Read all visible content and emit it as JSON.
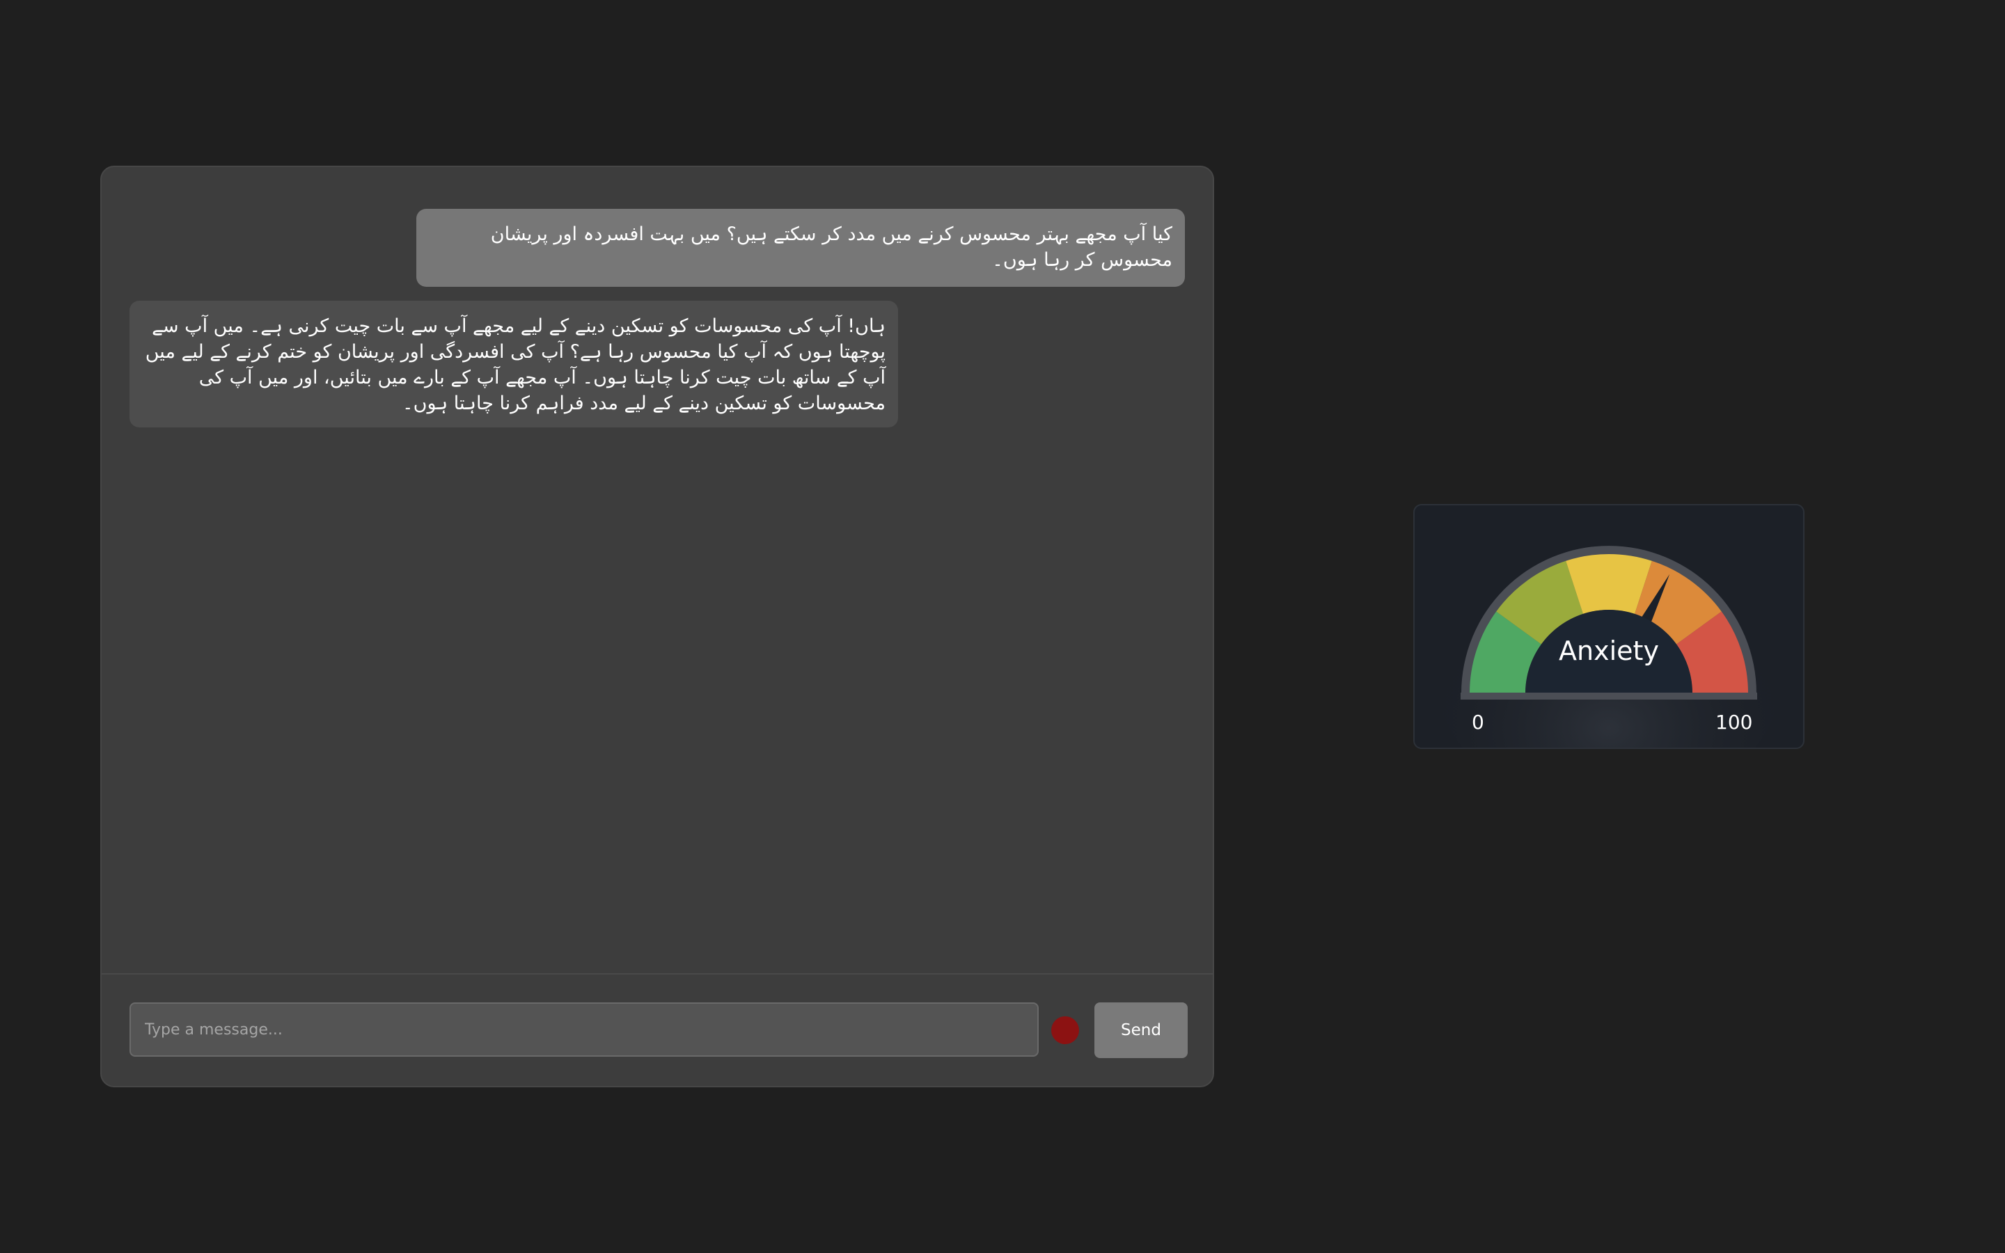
{
  "chat": {
    "messages": [
      {
        "role": "user",
        "text": "کیا آپ مجھے بہتر محسوس کرنے میں مدد کر سکتے ہیں؟ میں بہت افسردہ اور پریشان محسوس کر رہا ہوں۔"
      },
      {
        "role": "bot",
        "text": "ہاں! آپ کی محسوسات کو تسکین دینے کے لیے مجھے آپ سے بات چیت کرنی ہے۔ میں آپ سے پوچھتا ہوں کہ آپ کیا محسوس رہا ہے؟ آپ کی افسردگی اور پریشان کو ختم کرنے کے لیے میں آپ کے ساتھ بات چیت کرنا چاہتا ہوں۔ آپ مجھے آپ کے بارے میں بتائیں، اور میں آپ کی محسوسات کو تسکین دینے کے لیے مدد فراہم کرنا چاہتا ہوں۔"
      }
    ],
    "input": {
      "value": "",
      "placeholder": "Type a message..."
    },
    "send_label": "Send"
  },
  "gauge": {
    "label": "Anxiety",
    "min_label": "0",
    "max_label": "100",
    "min": 0,
    "max": 100,
    "value": 65,
    "segment_colors": [
      "#4fa863",
      "#9aab3c",
      "#e7c444",
      "#dc8a3a",
      "#d35546"
    ],
    "center_color": "#1c2531"
  },
  "colors": {
    "background": "#1f1f1f",
    "panel": "#3d3d3d",
    "user_bubble": "#777777",
    "bot_bubble": "#4d4d4d",
    "record_button": "#8c1212",
    "send_button": "#7a7a7a"
  },
  "icons": {
    "record": "record-icon"
  }
}
